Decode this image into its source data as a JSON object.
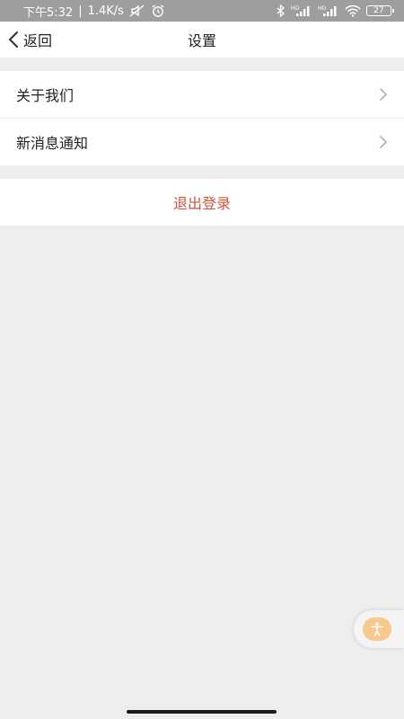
{
  "status_bar": {
    "time": "下午5:32",
    "speed": "1.4K/s",
    "signal_label_1": "HD",
    "signal_label_2": "HD",
    "battery": "27",
    "icons": [
      "mute-icon",
      "alarm-icon",
      "bluetooth-icon",
      "signal-icon",
      "signal-icon",
      "wifi-icon",
      "battery-icon"
    ]
  },
  "header": {
    "back_label": "返回",
    "title": "设置"
  },
  "settings": {
    "items": [
      {
        "label": "关于我们",
        "icon": "chevron-right-icon"
      },
      {
        "label": "新消息通知",
        "icon": "chevron-right-icon"
      }
    ]
  },
  "logout": {
    "label": "退出登录"
  },
  "floating_button": {
    "icon": "accessibility-icon"
  },
  "colors": {
    "status_bar_bg": "#9e9e9e",
    "page_bg": "#eeeeee",
    "logout_text": "#d0533c",
    "float_accent": "#f7c98d"
  }
}
